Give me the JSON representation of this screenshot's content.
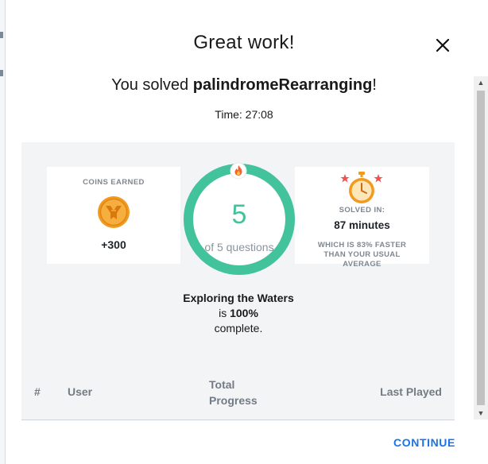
{
  "modal": {
    "title": "Great work!",
    "solved_prefix": "You solved ",
    "task_name": "palindromeRearranging",
    "solved_suffix": "!",
    "time_line": "Time: 27:08"
  },
  "stats": {
    "coins": {
      "label": "COINS EARNED",
      "value": "+300",
      "icon": "coin-icon"
    },
    "progress": {
      "completed": "5",
      "total_text": "of 5 questions",
      "fraction": 1.0,
      "ring_color": "#43c39b",
      "badge_icon": "flame-icon"
    },
    "topic": {
      "name": "Exploring the Waters",
      "is_text": " is ",
      "percent": "100%",
      "complete_text": "complete."
    },
    "solved_in": {
      "label": "SOLVED IN:",
      "value": "87 minutes",
      "note": "WHICH IS 83% FASTER THAN YOUR USUAL AVERAGE",
      "icon": "stopwatch-icon"
    }
  },
  "leaderboard": {
    "columns": [
      "#",
      "User",
      "Total Progress",
      "Last Played"
    ]
  },
  "actions": {
    "continue_label": "CONTINUE"
  },
  "colors": {
    "accent_green": "#43c39b",
    "link_blue": "#1a73e8",
    "coin_orange": "#f29a20"
  }
}
